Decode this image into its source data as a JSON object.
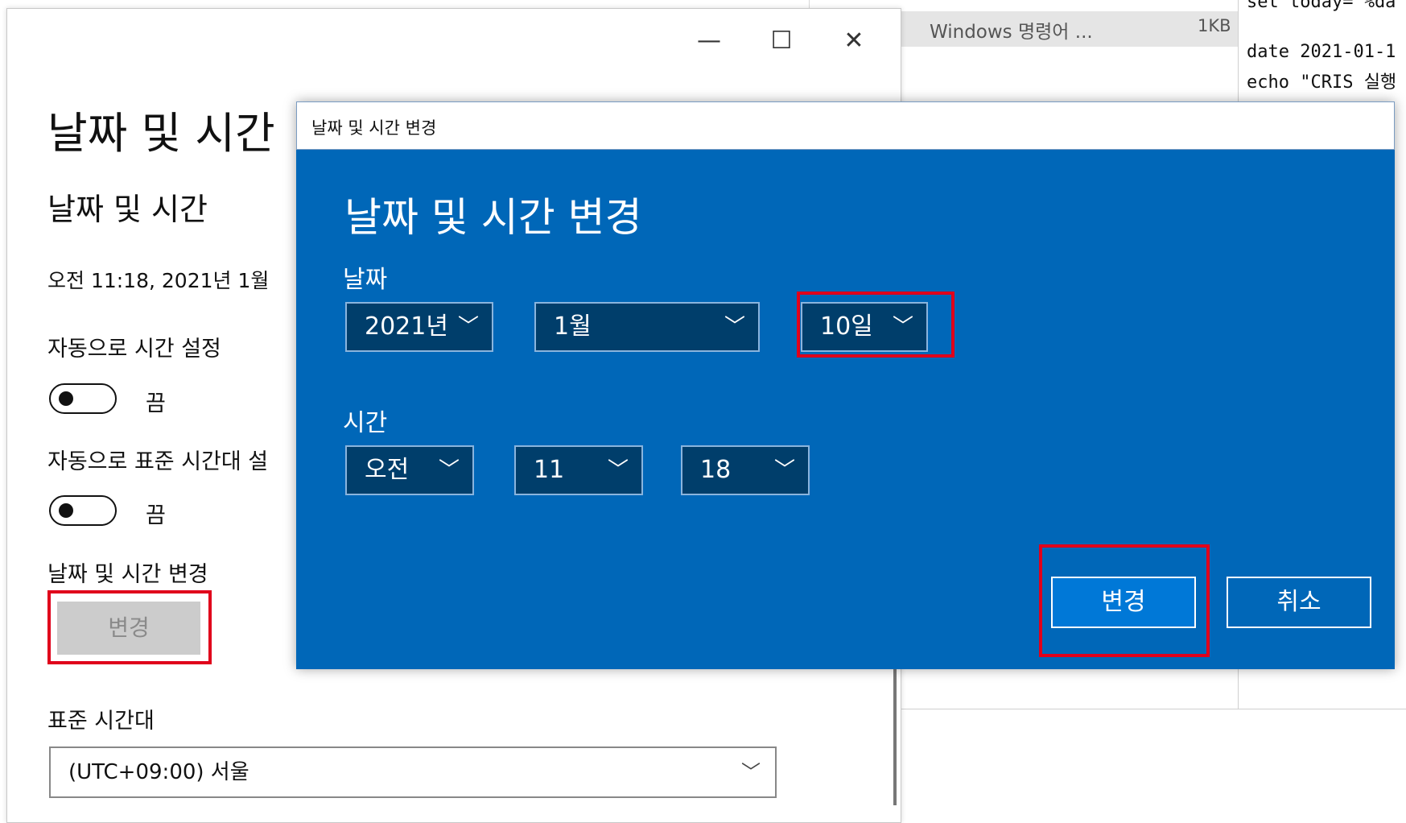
{
  "explorer": {
    "file_name": "Windows 명령어 ...",
    "file_size": "1KB"
  },
  "notepad": {
    "lines": [
      "set today= %da",
      "",
      "date 2021-01-1",
      "echo \"CRIS 실행"
    ]
  },
  "settings": {
    "window_controls": {
      "minimize": "—",
      "maximize": "☐",
      "close": "✕"
    },
    "title": "날짜 및 시간",
    "section_title": "날짜 및 시간",
    "current_time": "오전 11:18, 2021년 1월",
    "auto_time_label": "자동으로 시간 설정",
    "auto_time_state": "끔",
    "auto_tz_label": "자동으로 표준 시간대 설",
    "auto_tz_state": "끔",
    "change_label": "날짜 및 시간 변경",
    "change_button": "변경",
    "timezone_label": "표준 시간대",
    "timezone_value": "(UTC+09:00) 서울",
    "chevron": "﹀"
  },
  "dialog": {
    "titlebar": "날짜 및 시간 변경",
    "heading": "날짜 및 시간 변경",
    "date_label": "날짜",
    "year": "2021년",
    "month": "1월",
    "day": "10일",
    "time_label": "시간",
    "ampm": "오전",
    "hour": "11",
    "minute": "18",
    "chevron": "﹀",
    "change_button": "변경",
    "cancel_button": "취소"
  },
  "colors": {
    "dialog_bg": "#0067b8",
    "dropdown_bg": "#003e6b",
    "primary_button": "#0078d7",
    "highlight_box": "#e0001b"
  }
}
